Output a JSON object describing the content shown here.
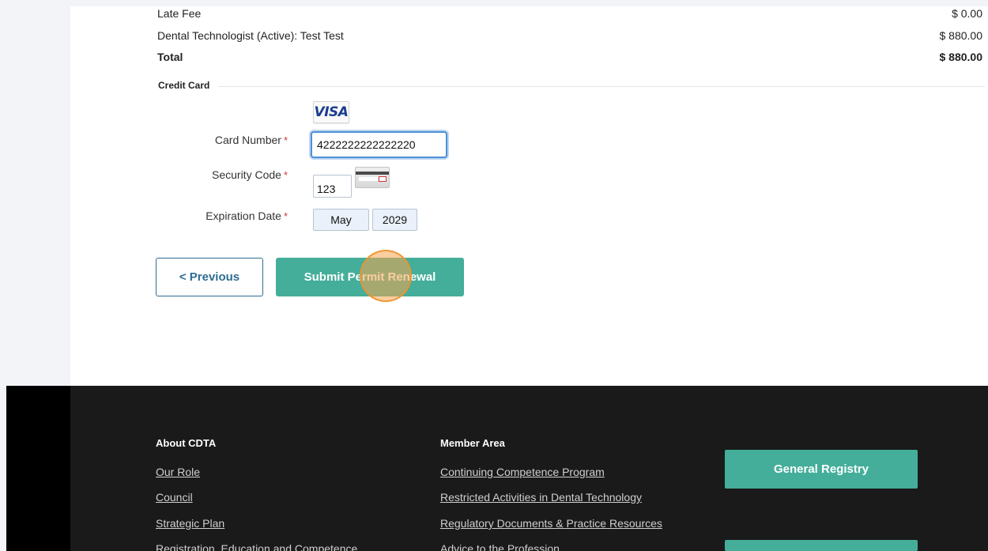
{
  "fees": {
    "rows": [
      {
        "label": "Late Fee",
        "amount": "$ 0.00"
      },
      {
        "label": "Dental Technologist (Active): Test Test",
        "amount": "$ 880.00"
      }
    ],
    "total": {
      "label": "Total",
      "amount": "$ 880.00"
    }
  },
  "credit_card": {
    "section_label": "Credit Card",
    "card_brand": "VISA",
    "card_number": {
      "label": "Card Number",
      "value": "4222222222222220"
    },
    "security_code": {
      "label": "Security Code",
      "value": "123"
    },
    "expiration": {
      "label": "Expiration Date",
      "month": "May",
      "year": "2029"
    },
    "required_marker": "*"
  },
  "actions": {
    "previous_label": "< Previous",
    "submit_label": "Submit Permit Renewal"
  },
  "footer": {
    "about": {
      "heading": "About CDTA",
      "links": [
        "Our Role",
        "Council",
        "Strategic Plan",
        "Registration, Education and Competence"
      ]
    },
    "member": {
      "heading": "Member Area",
      "links": [
        "Continuing Competence Program",
        "Restricted Activities in Dental Technology",
        "Regulatory Documents & Practice Resources",
        "Advice to the Profession"
      ]
    },
    "registry_button": "General Registry"
  },
  "colors": {
    "accent": "#44ae9a",
    "link_blue": "#2e6d93",
    "footer_bg": "#1a1a1a",
    "required": "#d0363b"
  }
}
